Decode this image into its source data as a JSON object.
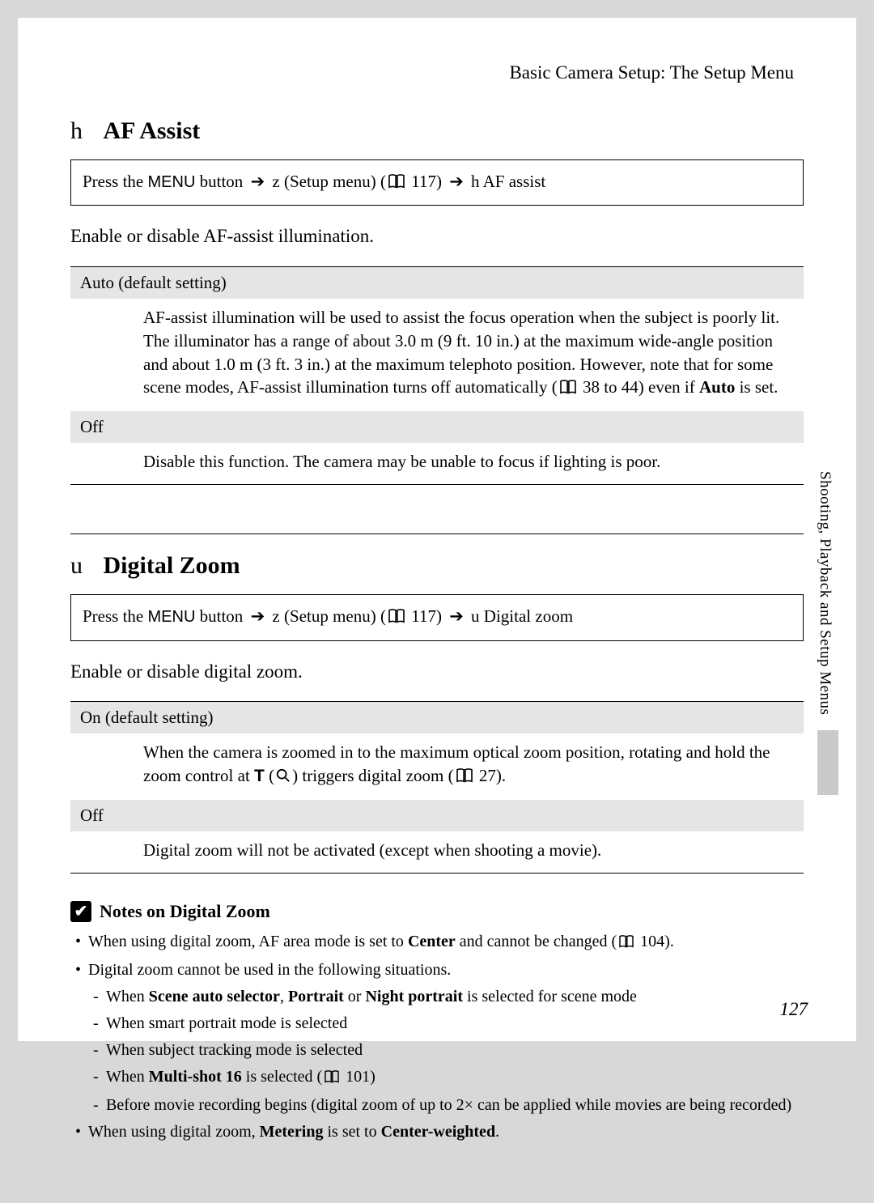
{
  "header": "Basic Camera Setup: The Setup Menu",
  "side_label": "Shooting, Playback and Setup Menus",
  "page_number": "127",
  "section1": {
    "prefix": "h",
    "title": "AF Assist",
    "nav": {
      "press": "Press the ",
      "menu": "MENU",
      "button": " button ",
      "z": " z  (Setup menu) (",
      "ref": " 117) ",
      "tail": " h   AF assist"
    },
    "intro": "Enable or disable AF-assist illumination.",
    "opts": [
      {
        "label": "Auto (default setting)",
        "desc_a": "AF-assist illumination will be used to assist the focus operation when the subject is poorly lit. The illuminator has a range of about 3.0 m (9 ft. 10 in.) at the maximum wide-angle position and about 1.0 m (3 ft. 3 in.) at the maximum telephoto position. However, note that for some scene modes, AF-assist illumination turns off automatically (",
        "desc_ref": " 38 to 44) even if ",
        "desc_bold": "Auto",
        "desc_b": " is set."
      },
      {
        "label": "Off",
        "desc_a": "Disable this function. The camera may be unable to focus if lighting is poor."
      }
    ]
  },
  "section2": {
    "prefix": "u",
    "title": "Digital Zoom",
    "nav": {
      "press": "Press the ",
      "menu": "MENU",
      "button": " button ",
      "z": " z  (Setup menu) (",
      "ref": " 117) ",
      "tail": " u   Digital zoom"
    },
    "intro": "Enable or disable digital zoom.",
    "opts": [
      {
        "label": "On (default setting)",
        "desc_a": "When the camera is zoomed in to the maximum optical zoom position, rotating and hold the zoom control at ",
        "t": "T",
        "paren": " (",
        "paren2": ") triggers digital zoom (",
        "ref": " 27)."
      },
      {
        "label": "Off",
        "desc_a": "Digital zoom will not be activated (except when shooting a movie)."
      }
    ]
  },
  "notes": {
    "title": "Notes on Digital Zoom",
    "b1_a": "When using digital zoom, AF area mode is set to ",
    "b1_bold": "Center",
    "b1_b": " and cannot be changed (",
    "b1_ref": " 104).",
    "b2": "Digital zoom cannot be used in the following situations.",
    "b2_1_a": "When ",
    "b2_1_b1": "Scene auto selector",
    "b2_1_c": ", ",
    "b2_1_b2": "Portrait",
    "b2_1_d": " or ",
    "b2_1_b3": "Night portrait",
    "b2_1_e": " is selected for scene mode",
    "b2_2": "When smart portrait mode is selected",
    "b2_3": "When subject tracking mode is selected",
    "b2_4_a": "When ",
    "b2_4_b": "Multi-shot 16",
    "b2_4_c": " is selected (",
    "b2_4_ref": " 101)",
    "b2_5": "Before movie recording begins (digital zoom of up to 2× can be applied while movies are being recorded)",
    "b3_a": "When using digital zoom, ",
    "b3_b1": "Metering",
    "b3_b": " is set to ",
    "b3_b2": "Center-weighted",
    "b3_c": "."
  }
}
